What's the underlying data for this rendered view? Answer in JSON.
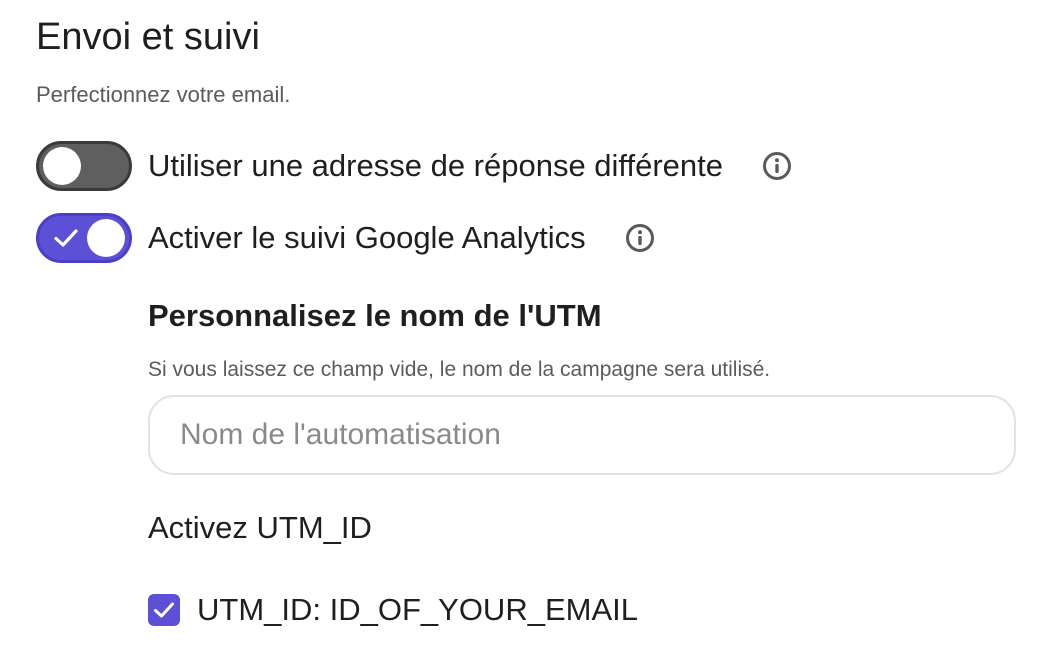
{
  "section": {
    "title": "Envoi et suivi",
    "subtitle": "Perfectionnez votre email."
  },
  "toggles": [
    {
      "label": "Utiliser une adresse de réponse différente",
      "checked": false,
      "icon": "info-icon"
    },
    {
      "label": "Activer le suivi Google Analytics",
      "checked": true,
      "icon": "info-icon"
    }
  ],
  "utm": {
    "heading": "Personnalisez le nom de l'UTM",
    "help": "Si vous laissez ce champ vide, le nom de la campagne sera utilisé.",
    "input_value": "",
    "input_placeholder": "Nom de l'automatisation"
  },
  "utm_id": {
    "heading": "Activez UTM_ID",
    "checkbox_label": "UTM_ID: ID_OF_YOUR_EMAIL",
    "checked": true
  },
  "colors": {
    "accent": "#5b50d6",
    "toggle_off": "#5f5f5f",
    "text": "#1f1f1f",
    "muted_text": "#5b5b5b"
  }
}
